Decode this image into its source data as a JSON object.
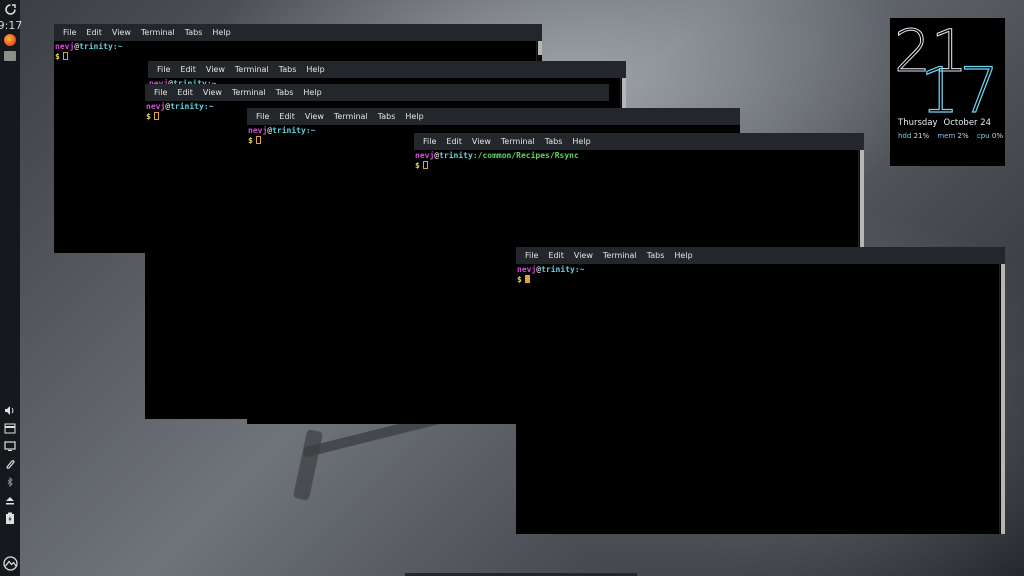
{
  "panel": {
    "clock": "9:17",
    "launchers": [
      "power-icon",
      "firefox-icon",
      "files-icon"
    ],
    "tray": [
      "volume-icon",
      "clipboard-icon",
      "display-icon",
      "paperclip-icon",
      "bluetooth-icon",
      "eject-icon",
      "battery-icon"
    ]
  },
  "menu": [
    "File",
    "Edit",
    "View",
    "Terminal",
    "Tabs",
    "Help"
  ],
  "terminals": [
    {
      "user": "nevj",
      "host": "trinity",
      "path": ":~"
    },
    {
      "user": "nevj",
      "host": "trinity",
      "path": ":~"
    },
    {
      "user": "nevj",
      "host": "trinity",
      "path": ":~"
    },
    {
      "user": "nevj",
      "host": "trinity",
      "path": ":~"
    },
    {
      "user": "nevj",
      "host": "trinity",
      "path": ":/common/Recipes/Rsync"
    },
    {
      "user": "nevj",
      "host": "trinity",
      "path": ":~"
    }
  ],
  "prompt_symbol": "$",
  "widget": {
    "hour": "21",
    "minute": "17",
    "day": "Thursday",
    "date": "October 24",
    "hdd_label": "hdd",
    "hdd_value": "21%",
    "mem_label": "mem",
    "mem_value": "2%",
    "cpu_label": "cpu",
    "cpu_value": "0%"
  }
}
